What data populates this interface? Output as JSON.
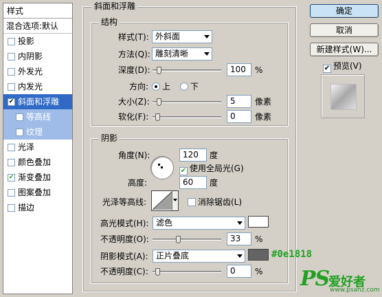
{
  "styles": {
    "header": "样式",
    "blend_options": "混合选项:默认",
    "items": [
      {
        "label": "投影",
        "checked": false
      },
      {
        "label": "内阴影",
        "checked": false
      },
      {
        "label": "外发光",
        "checked": false
      },
      {
        "label": "内发光",
        "checked": false
      },
      {
        "label": "斜面和浮雕",
        "checked": true,
        "selected": true
      },
      {
        "label": "等高线",
        "checked": false,
        "sub": true
      },
      {
        "label": "纹理",
        "checked": false,
        "sub": true
      },
      {
        "label": "光泽",
        "checked": false
      },
      {
        "label": "颜色叠加",
        "checked": false
      },
      {
        "label": "渐变叠加",
        "checked": true
      },
      {
        "label": "图案叠加",
        "checked": false
      },
      {
        "label": "描边",
        "checked": false
      }
    ]
  },
  "bevel": {
    "title": "斜面和浮雕",
    "structure_title": "结构",
    "style_label": "样式(T):",
    "style_value": "外斜面",
    "technique_label": "方法(Q):",
    "technique_value": "雕刻清晰",
    "depth_label": "深度(D):",
    "depth_value": "100",
    "depth_unit": "%",
    "depth_level": 0.02,
    "direction_label": "方向:",
    "direction_up": "上",
    "direction_down": "下",
    "size_label": "大小(Z):",
    "size_value": "5",
    "size_unit": "像素",
    "size_level": 0.02,
    "soften_label": "软化(F):",
    "soften_value": "0",
    "soften_unit": "像素",
    "soften_level": 0.0
  },
  "shading": {
    "title": "阴影",
    "angle_label": "角度(N):",
    "angle_value": "120",
    "angle_unit": "度",
    "global_light_label": "使用全局光(G)",
    "global_light_checked": true,
    "altitude_label": "高度:",
    "altitude_value": "60",
    "altitude_unit": "度",
    "gloss_label": "光泽等高线:",
    "antialias_label": "消除锯齿(L)",
    "highlight_mode_label": "高光模式(H):",
    "highlight_mode_value": "滤色",
    "highlight_color": "#ffffff",
    "highlight_opacity_label": "不透明度(O):",
    "highlight_opacity_value": "33",
    "highlight_opacity_unit": "%",
    "highlight_opacity_level": 0.33,
    "shadow_mode_label": "阴影模式(A):",
    "shadow_mode_value": "正片叠底",
    "shadow_color": "#646464",
    "shadow_opacity_label": "不透明度(C):",
    "shadow_opacity_value": "0",
    "shadow_opacity_unit": "%",
    "shadow_opacity_level": 0.0
  },
  "buttons": {
    "ok": "确定",
    "cancel": "取消",
    "new_style": "新建样式(W)...",
    "preview_label": "预览(V)",
    "preview_checked": true
  },
  "annotation": "#0e1818",
  "watermark": {
    "logo": "PS",
    "text": "爱好者",
    "url": "www.psahz.com"
  },
  "colors": {
    "selection": "#316ac5",
    "sub_selection": "#9fbce8",
    "annotation": "#21a121"
  }
}
